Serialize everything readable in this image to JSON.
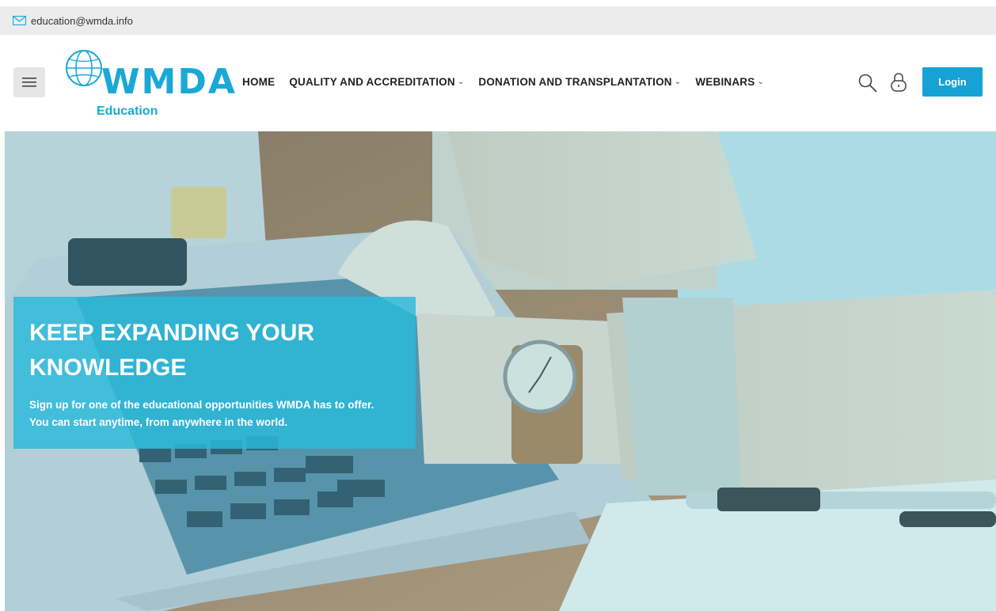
{
  "topbar": {
    "email": "education@wmda.info",
    "icon": "mail-icon"
  },
  "header": {
    "logo": {
      "word": "WMDA",
      "sub": "Education"
    },
    "nav": [
      {
        "label": "HOME",
        "dropdown": false
      },
      {
        "label": "QUALITY AND ACCREDITATION",
        "dropdown": true
      },
      {
        "label": "DONATION AND TRANSPLANTATION",
        "dropdown": true
      },
      {
        "label": "WEBINARS",
        "dropdown": true
      }
    ],
    "login_label": "Login"
  },
  "hero": {
    "title": "KEEP EXPANDING YOUR KNOWLEDGE",
    "line1": "Sign up for one of the educational opportunities WMDA has to offer.",
    "line2": "You can start anytime, from anywhere in the world."
  },
  "colors": {
    "accent": "#17a2d6",
    "topbar": "#ececec"
  }
}
